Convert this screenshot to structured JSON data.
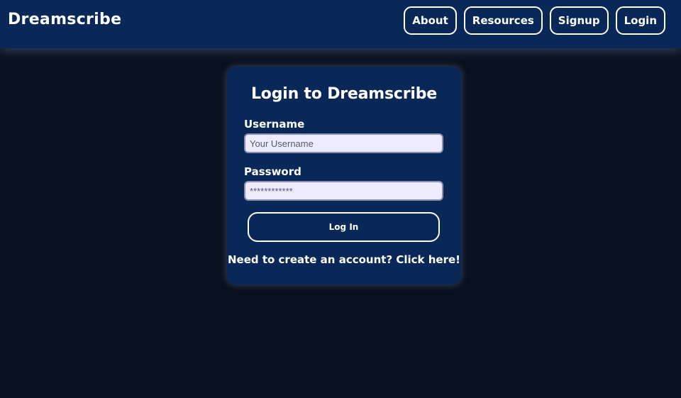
{
  "navbar": {
    "brand": "Dreamscribe",
    "links": [
      {
        "label": "About"
      },
      {
        "label": "Resources"
      },
      {
        "label": "Signup"
      },
      {
        "label": "Login"
      }
    ]
  },
  "login_form": {
    "title": "Login to Dreamscribe",
    "username_label": "Username",
    "username_placeholder": "Your Username",
    "username_value": "",
    "password_label": "Password",
    "password_placeholder": "************",
    "password_value": "",
    "submit_label": "Log In",
    "signup_link": "Need to create an account? Click here!"
  },
  "colors": {
    "background": "#0a111e",
    "navbar": "#0a2857",
    "card": "#0a2857",
    "input_background": "#eeebff",
    "text": "#ffffff"
  }
}
